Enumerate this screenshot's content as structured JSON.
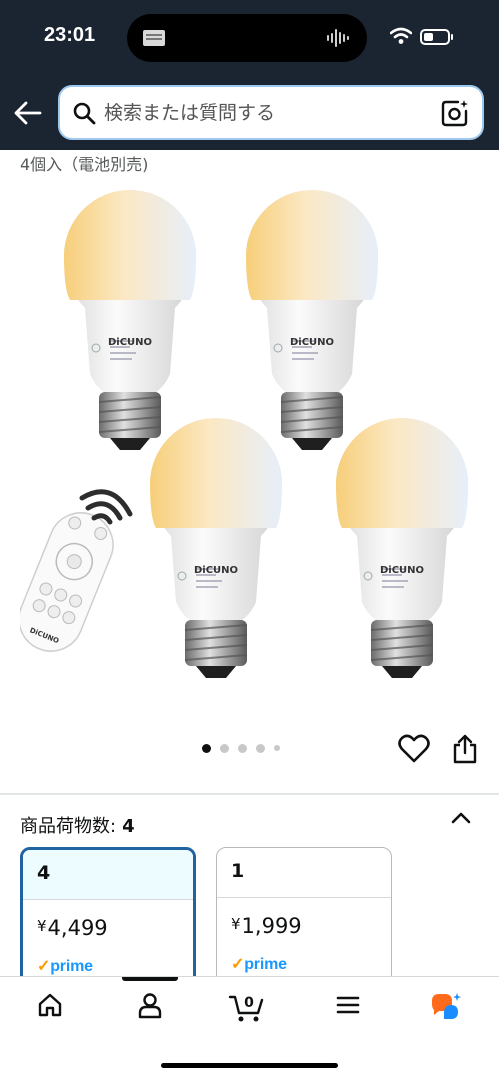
{
  "status_bar": {
    "time": "23:01"
  },
  "search": {
    "placeholder": "検索または質問する"
  },
  "product": {
    "subtitle": "4個入（電池別売)",
    "brand_text": "DiCUNO",
    "carousel": {
      "total_images": 5,
      "active_index": 0
    }
  },
  "quantity": {
    "label": "商品荷物数:",
    "selected_value": "4",
    "options": [
      {
        "count": "4",
        "currency": "¥",
        "price": "4,499",
        "badge": "prime",
        "selected": true
      },
      {
        "count": "1",
        "currency": "¥",
        "price": "1,999",
        "badge": "prime",
        "selected": false
      }
    ]
  },
  "bottom_nav": {
    "items": [
      "home-icon",
      "account-icon",
      "cart-icon",
      "menu-icon",
      "rufus-icon"
    ],
    "cart_count": "0",
    "active": "account-icon"
  },
  "colors": {
    "header_bg": "#1b2532",
    "selected_border": "#2162a1",
    "prime_blue": "#1a98ff",
    "prime_check": "#ff9900",
    "rufus_orange": "#ff6b1a",
    "rufus_blue": "#1a8cff"
  }
}
